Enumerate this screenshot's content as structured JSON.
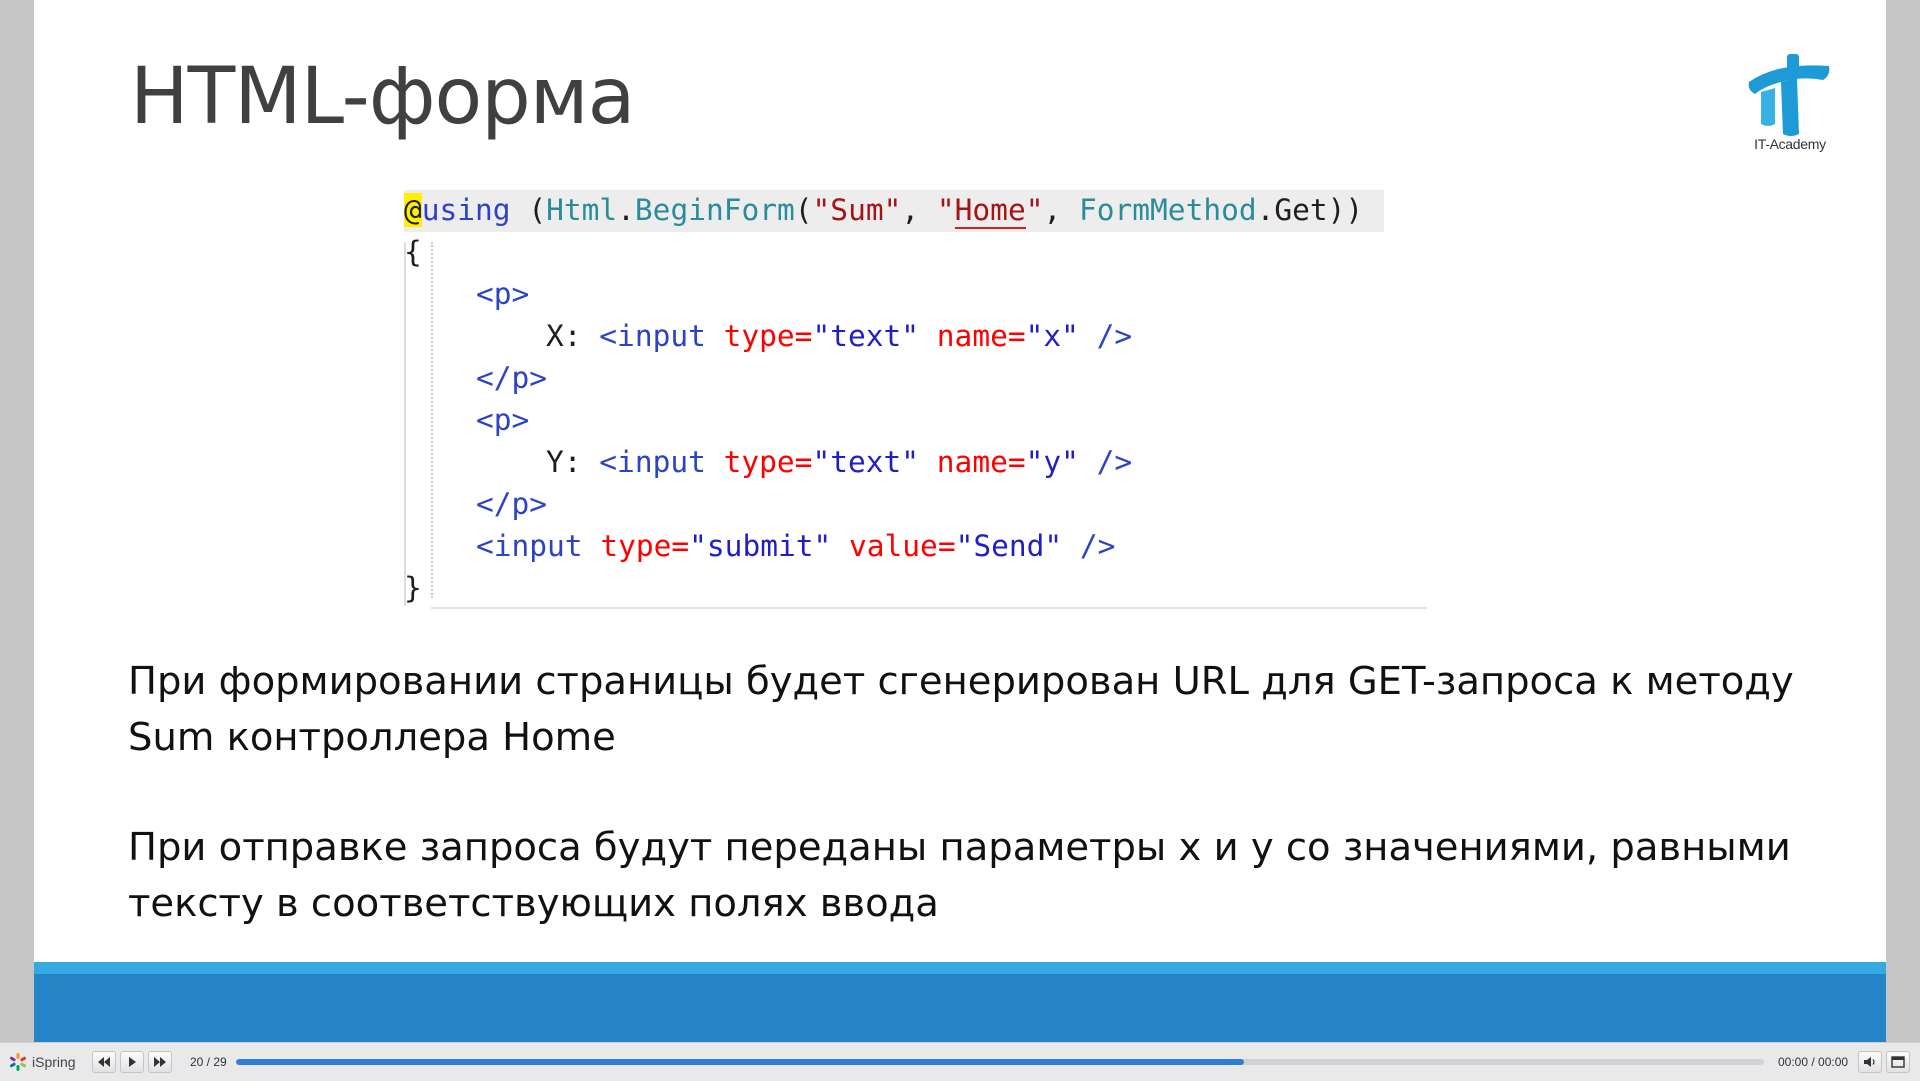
{
  "slide": {
    "title": "HTML-форма",
    "logo_text": "IT-Academy",
    "code": {
      "line1": {
        "at": "@",
        "using": "using",
        "space_paren": " (",
        "html": "Html",
        "dot": ".",
        "begin": "BeginForm",
        "open": "(",
        "sum": "\"Sum\"",
        "comma1": ", ",
        "q1": "\"",
        "home": "Home",
        "q2": "\"",
        "comma2": ", ",
        "formmethod": "FormMethod",
        "dot2": ".",
        "get": "Get",
        "close": "))"
      },
      "open_brace": "{",
      "p_open_1": "<p>",
      "x_label": "X: ",
      "input_tag": "<input",
      "type_attr": " type=",
      "text_val": "\"text\"",
      "name_attr": " name=",
      "x_val": "\"x\"",
      "self_close": " />",
      "p_close_1": "</p>",
      "p_open_2": "<p>",
      "y_label": "Y: ",
      "y_val": "\"y\"",
      "p_close_2": "</p>",
      "submit_val": "\"submit\"",
      "value_attr": " value=",
      "send_val": "\"Send\"",
      "close_brace": "}"
    },
    "paragraph1": "При формировании страницы будет сгенерирован URL для GET-запроса к методу Sum контроллера Home",
    "paragraph2": "При отправке запроса будут переданы параметры x и y со значениями, равными тексту в соответствующих полях ввода"
  },
  "player": {
    "brand": "iSpring",
    "current_slide": 20,
    "total_slides": 29,
    "slide_counter": "20 / 29",
    "progress": 0.66,
    "time": "00:00 / 00:00",
    "icons": [
      "ispring-logo-icon",
      "prev-slide-icon",
      "play-icon",
      "next-slide-icon",
      "volume-icon",
      "fullscreen-icon"
    ]
  },
  "colors": {
    "footer_light": "#36a9e1",
    "footer_band": "#2584c6",
    "progress_fill": "#2f7fd1",
    "logo": "#1e9bd7"
  }
}
